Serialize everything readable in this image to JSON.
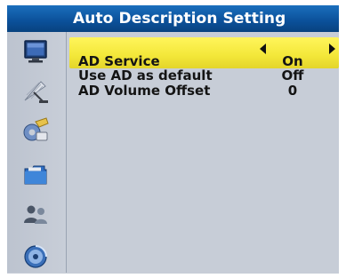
{
  "window": {
    "title": "Auto Description Setting"
  },
  "sidebar": {
    "icons": [
      {
        "name": "tv-monitor-icon"
      },
      {
        "name": "satellite-dish-icon"
      },
      {
        "name": "installation-tools-icon"
      },
      {
        "name": "folder-icon"
      },
      {
        "name": "people-icon"
      },
      {
        "name": "media-disc-icon"
      }
    ]
  },
  "menu": {
    "rows": [
      {
        "label": "AD Service",
        "value": "On"
      },
      {
        "label": "Use AD as default",
        "value": "Off"
      },
      {
        "label": "AD Volume Offset",
        "value": "0"
      }
    ]
  },
  "colors": {
    "title_bar": "#0b5099",
    "highlight": "#f3e739",
    "panel": "#c7cdd7"
  }
}
